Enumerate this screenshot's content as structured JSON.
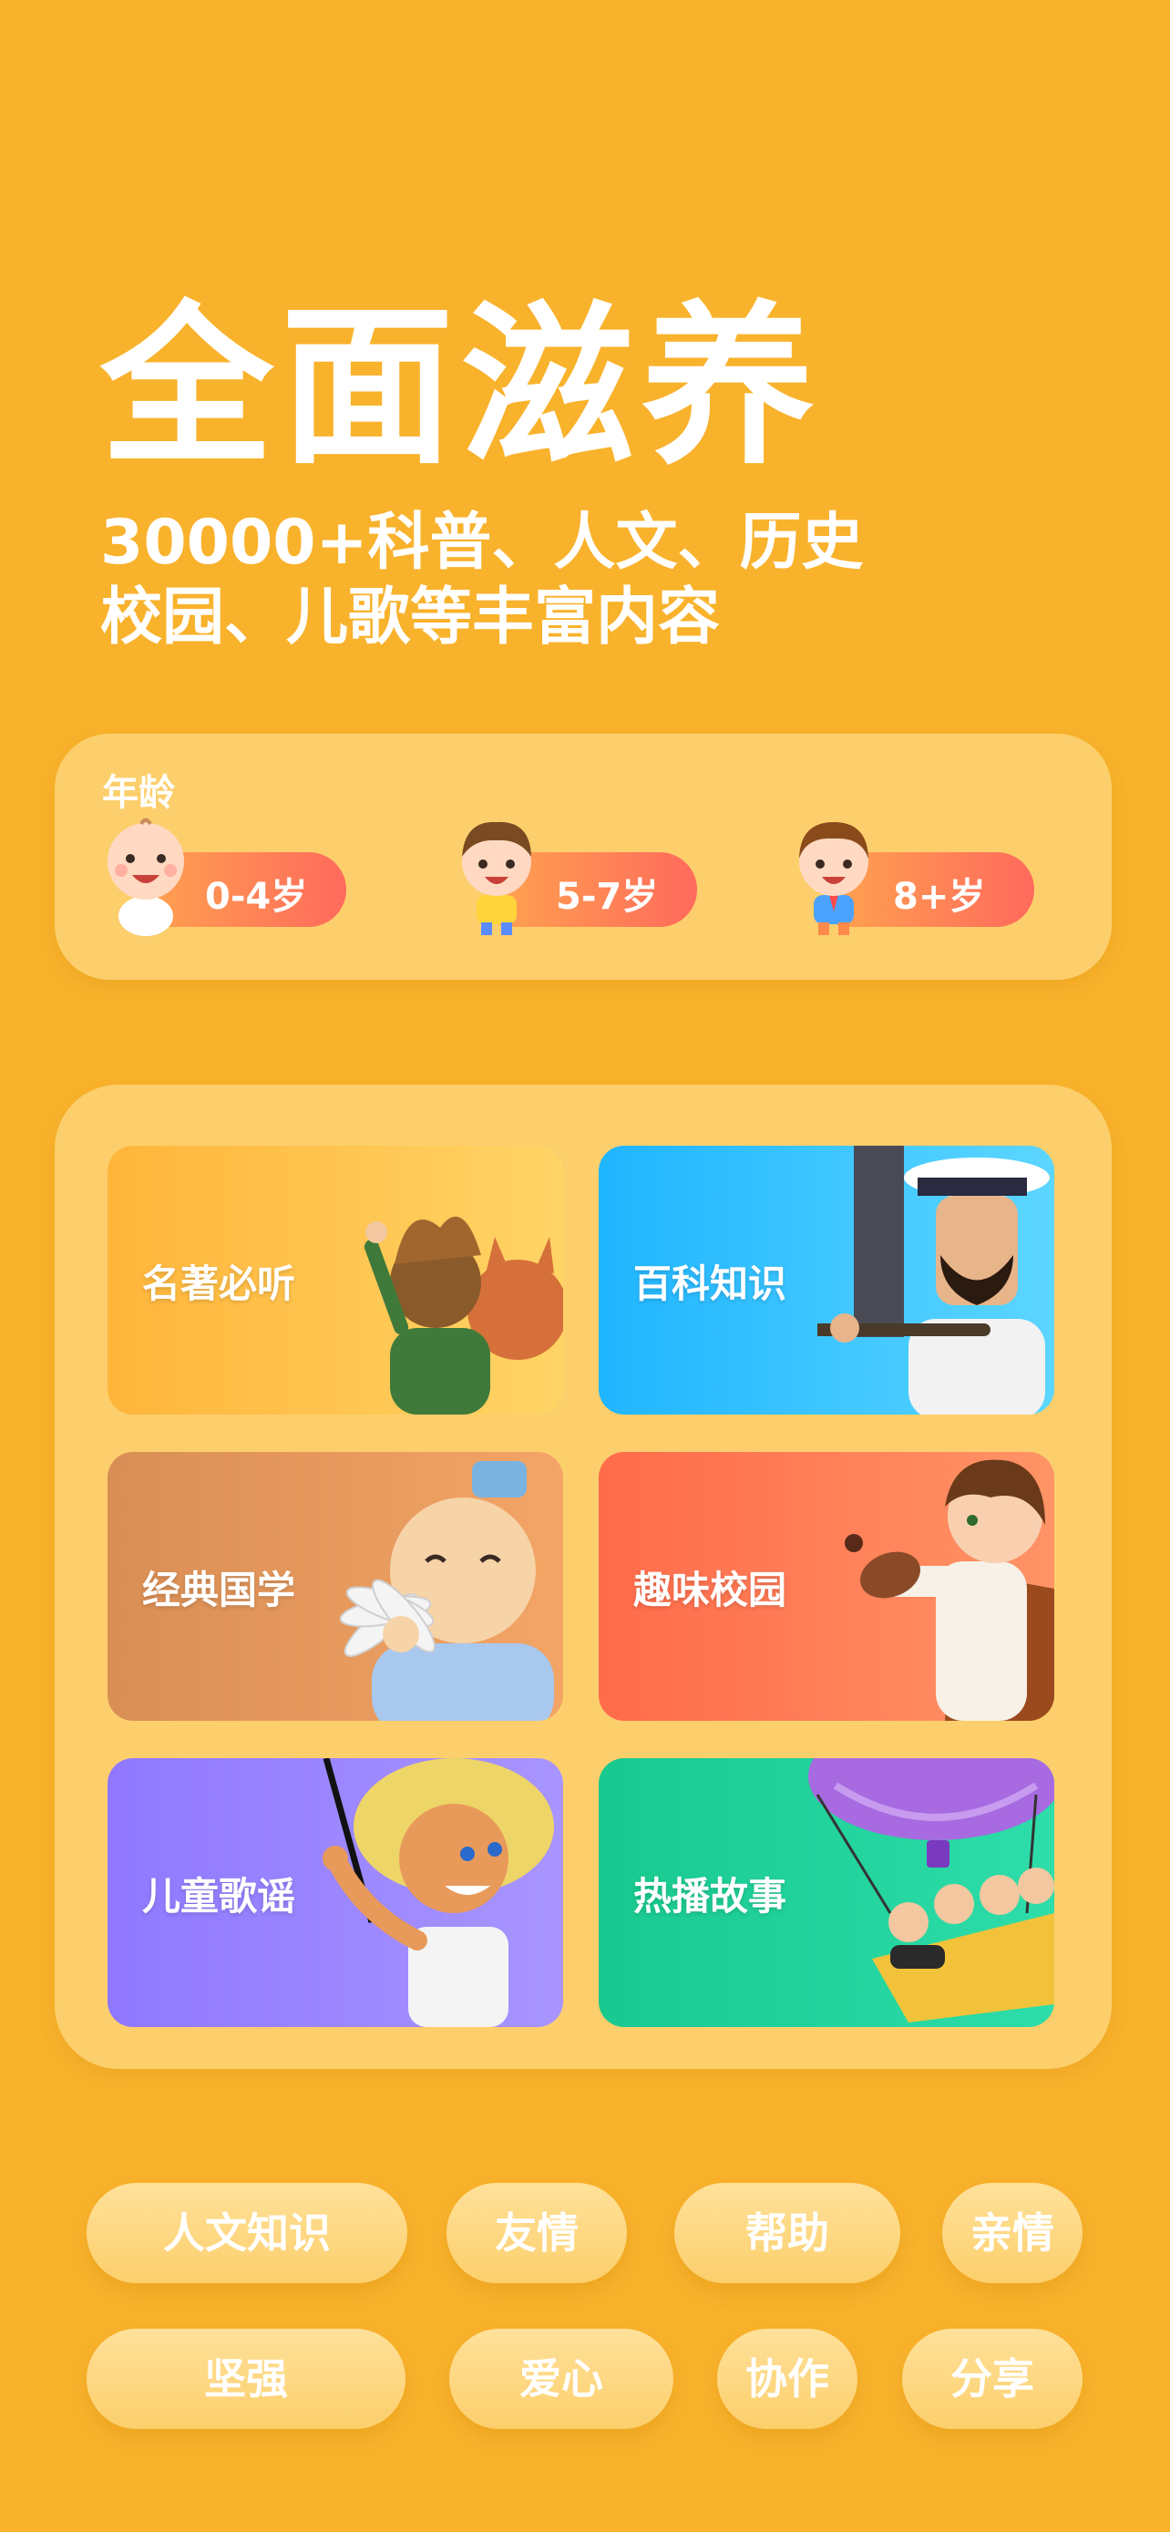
{
  "hero": {
    "title": "全面滋养",
    "subtitle_line1": "30000+科普、人文、历史",
    "subtitle_line2": "校园、儿歌等丰富内容"
  },
  "age": {
    "label": "年龄",
    "options": [
      {
        "label": "0-4岁",
        "icon": "baby-icon"
      },
      {
        "label": "5-7岁",
        "icon": "boy-icon"
      },
      {
        "label": "8+岁",
        "icon": "schoolboy-icon"
      }
    ]
  },
  "categories": [
    {
      "label": "名著必听",
      "color_from": "#FFB53A",
      "color_to": "#FFD466",
      "icon": "little-prince-illustration"
    },
    {
      "label": "百科知识",
      "color_from": "#1FB5FF",
      "color_to": "#5CD6FF",
      "icon": "sailor-captain-illustration"
    },
    {
      "label": "经典国学",
      "color_from": "#D98E55",
      "color_to": "#F3A566",
      "icon": "scholar-illustration"
    },
    {
      "label": "趣味校园",
      "color_from": "#FF6B4A",
      "color_to": "#FF9466",
      "icon": "boy-slingshot-illustration"
    },
    {
      "label": "儿童歌谣",
      "color_from": "#8F78FF",
      "color_to": "#A895FF",
      "icon": "fisher-boy-illustration"
    },
    {
      "label": "热播故事",
      "color_from": "#18C98F",
      "color_to": "#2EDDAA",
      "icon": "hot-air-balloon-illustration"
    }
  ],
  "tags_row1": [
    "人文知识",
    "友情",
    "帮助",
    "亲情"
  ],
  "tags_row2": [
    "坚强",
    "爱心",
    "协作",
    "分享"
  ]
}
